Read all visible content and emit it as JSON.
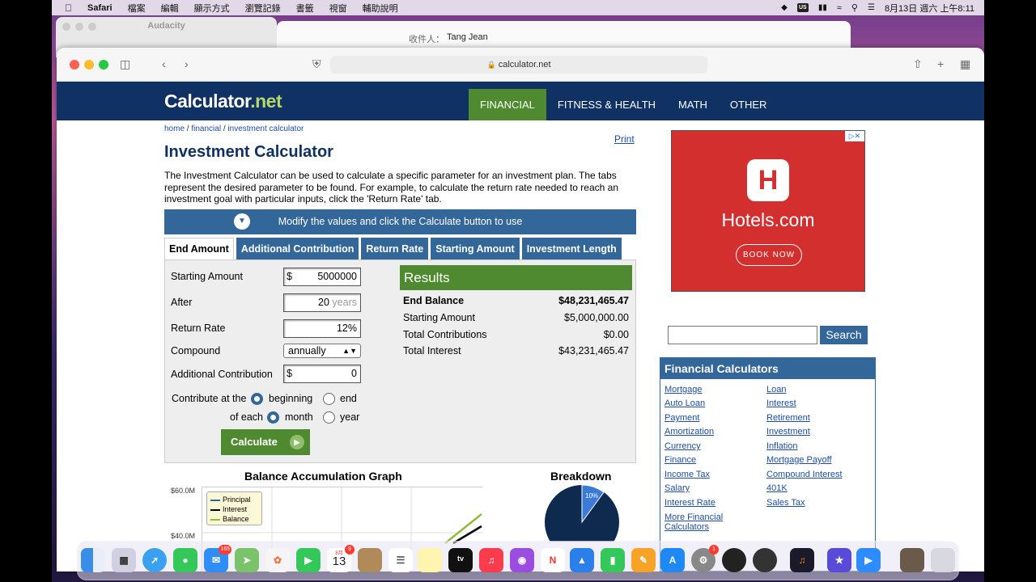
{
  "menubar": {
    "app": "Safari",
    "items": [
      "檔案",
      "編輯",
      "顯示方式",
      "瀏覽記錄",
      "書籤",
      "視窗",
      "輔助說明"
    ],
    "input_badge": "US",
    "datetime": "8月13日 週六 上午8:11"
  },
  "bg_windows": {
    "audacity_title": "Audacity",
    "mail_to_label": "收件人：",
    "mail_to_value": "Tang Jean"
  },
  "browser": {
    "url": "calculator.net"
  },
  "site": {
    "logo_main": "Calculator",
    "logo_dot": ".net",
    "nav": [
      "FINANCIAL",
      "FITNESS & HEALTH",
      "MATH",
      "OTHER"
    ],
    "breadcrumb": [
      "home",
      "financial",
      "investment calculator"
    ],
    "print": "Print",
    "title": "Investment Calculator",
    "intro": "The Investment Calculator can be used to calculate a specific parameter for an investment plan. The tabs represent the desired parameter to be found. For example, to calculate the return rate needed to reach an investment goal with particular inputs, click the 'Return Rate' tab.",
    "modify_bar": "Modify the values and click the Calculate button to use"
  },
  "tabs": [
    "End Amount",
    "Additional Contribution",
    "Return Rate",
    "Starting Amount",
    "Investment Length"
  ],
  "form": {
    "starting_amount_label": "Starting Amount",
    "starting_amount_prefix": "$",
    "starting_amount": "5000000",
    "after_label": "After",
    "after_value": "20",
    "after_suffix": "years",
    "return_rate_label": "Return Rate",
    "return_rate": "12",
    "return_rate_suffix": "%",
    "compound_label": "Compound",
    "compound_value": "annually",
    "addl_label": "Additional Contribution",
    "addl_prefix": "$",
    "addl_value": "0",
    "contribute_at": "Contribute at the",
    "beginning": "beginning",
    "end": "end",
    "of_each": "of each",
    "month": "month",
    "year": "year",
    "calculate": "Calculate"
  },
  "results": {
    "header": "Results",
    "rows": [
      {
        "k": "End Balance",
        "v": "$48,231,465.47"
      },
      {
        "k": "Starting Amount",
        "v": "$5,000,000.00"
      },
      {
        "k": "Total Contributions",
        "v": "$0.00"
      },
      {
        "k": "Total Interest",
        "v": "$43,231,465.47"
      }
    ]
  },
  "graph": {
    "title": "Balance Accumulation Graph",
    "y_ticks": [
      "$60.0M",
      "$40.0M"
    ],
    "legend": [
      "Principal",
      "Interest",
      "Balance"
    ],
    "colors": {
      "principal": "#336699",
      "interest": "#000000",
      "balance": "#8fbf3a"
    }
  },
  "breakdown": {
    "title": "Breakdown",
    "slice_label": "10%"
  },
  "ad": {
    "brand": "Hotels.com",
    "cta": "BOOK NOW"
  },
  "search": {
    "button": "Search"
  },
  "financial_calculators": {
    "header": "Financial Calculators",
    "left": [
      "Mortgage",
      "Auto Loan",
      "Payment",
      "Amortization",
      "Currency",
      "Finance",
      "Income Tax",
      "Salary",
      "Interest Rate",
      "More Financial Calculators"
    ],
    "right": [
      "Loan",
      "Interest",
      "Retirement",
      "Investment",
      "Inflation",
      "Mortgage Payoff",
      "Compound Interest",
      "401K",
      "Sales Tax"
    ]
  },
  "dock": {
    "mail_badge": "165",
    "calendar_month": "8月",
    "calendar_day": "13",
    "calendar_badge": "9",
    "settings_badge": "1"
  }
}
